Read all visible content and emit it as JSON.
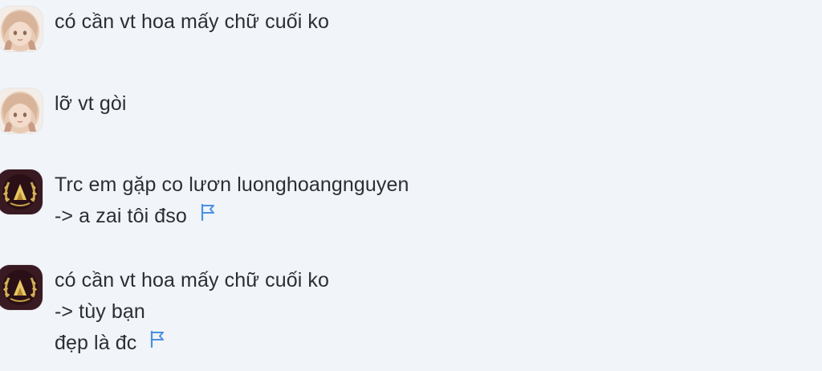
{
  "messages": [
    {
      "avatar": "anime-girl-avatar",
      "lines": [
        "có cần vt hoa mấy chữ cuối ko"
      ],
      "flag": false
    },
    {
      "avatar": "anime-girl-avatar",
      "lines": [
        "lỡ vt gòi"
      ],
      "flag": false
    },
    {
      "avatar": "laurel-emblem-avatar",
      "lines": [
        "Trc em gặp co lươn luonghoangnguyen",
        "-> a zai tôi đso"
      ],
      "flag": true
    },
    {
      "avatar": "laurel-emblem-avatar",
      "lines": [
        "có cần vt hoa mấy chữ cuối ko",
        "-> tùy bạn",
        "đẹp là đc"
      ],
      "flag": true
    }
  ],
  "colors": {
    "background": "#f1f4f8",
    "text": "#2a2f36",
    "flag": "#4a90e2"
  },
  "icons": {
    "flag": "flag-icon"
  }
}
